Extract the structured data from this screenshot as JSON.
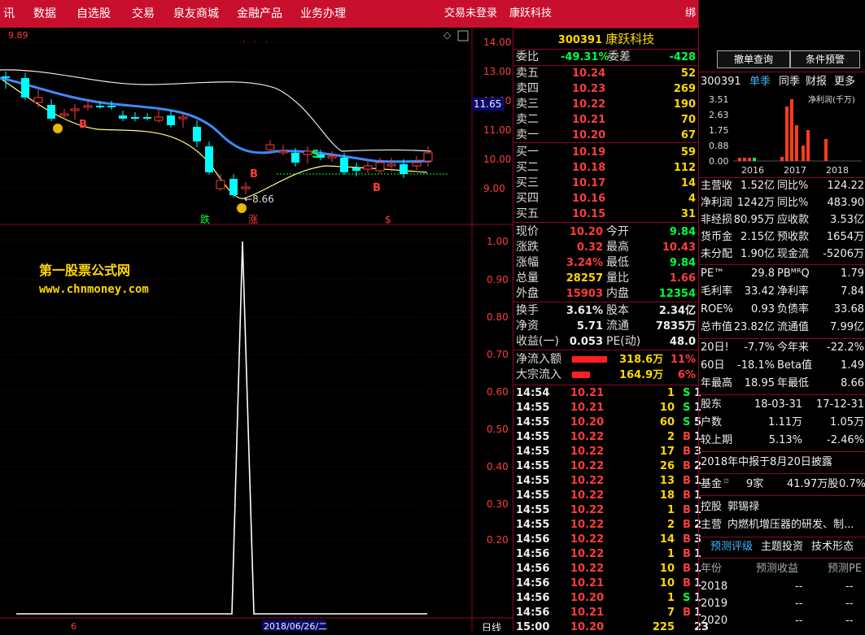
{
  "menu": {
    "items": [
      "讯",
      "数据",
      "自选股",
      "交易",
      "泉友商城",
      "金融产品",
      "业务办理"
    ],
    "login_status": "交易未登录",
    "stock_name_label": "康跃科技",
    "overflow_label": "绑"
  },
  "chart": {
    "low_label_top": "9.89",
    "price_axis": [
      "14.00",
      "13.00",
      "12.00",
      "11.00",
      "10.00",
      "9.00"
    ],
    "current_price_tag": "11.65",
    "low_marker": "8.66",
    "indicator_axis": [
      "1.00",
      "0.90",
      "0.80",
      "0.70",
      "0.60",
      "0.50",
      "0.40",
      "0.30",
      "0.20"
    ],
    "signals": {
      "b": "B",
      "s": "S",
      "die": "跌",
      "zhang": "涨",
      "dollar": "$"
    },
    "bottom_date": "2018/06/26/二",
    "bottom_mark": "6",
    "period_label": "日线",
    "watermark_cn": "第一股票公式网",
    "watermark_url": "www.chnmoney.com",
    "colors": {
      "up": "#ff3c3c",
      "down": "#00ffff",
      "ma": "#3c8cff",
      "band": "#ffffff",
      "yellow_line": "#ffff80"
    }
  },
  "chart_data": {
    "type": "line",
    "title": "",
    "xlabel": "",
    "ylabel": "",
    "ylim": [
      0,
      1.05
    ],
    "x": [
      0,
      1,
      2,
      3,
      4,
      5,
      6,
      7,
      8,
      9,
      10,
      11,
      12,
      13,
      14,
      15
    ],
    "series": [
      {
        "values": [
          0,
          0,
          0,
          0,
          0,
          0,
          0,
          0,
          0,
          0,
          0,
          1,
          0,
          0,
          0,
          0
        ]
      }
    ]
  },
  "quote": {
    "header_code": "300391",
    "header_name": "康跃科技",
    "weibi_label": "委比",
    "weibi_value": "-49.31%",
    "weicha_label": "委差",
    "weicha_value": "-428",
    "sell": [
      {
        "label": "卖五",
        "price": "10.24",
        "vol": "52"
      },
      {
        "label": "卖四",
        "price": "10.23",
        "vol": "269"
      },
      {
        "label": "卖三",
        "price": "10.22",
        "vol": "190"
      },
      {
        "label": "卖二",
        "price": "10.21",
        "vol": "70"
      },
      {
        "label": "卖一",
        "price": "10.20",
        "vol": "67"
      }
    ],
    "buy": [
      {
        "label": "买一",
        "price": "10.19",
        "vol": "59"
      },
      {
        "label": "买二",
        "price": "10.18",
        "vol": "112"
      },
      {
        "label": "买三",
        "price": "10.17",
        "vol": "14"
      },
      {
        "label": "买四",
        "price": "10.16",
        "vol": "4"
      },
      {
        "label": "买五",
        "price": "10.15",
        "vol": "31"
      }
    ],
    "stats": [
      {
        "l1": "现价",
        "v1": "10.20",
        "c1": "red",
        "l2": "今开",
        "v2": "9.84",
        "c2": "green"
      },
      {
        "l1": "涨跌",
        "v1": "0.32",
        "c1": "red",
        "l2": "最高",
        "v2": "10.43",
        "c2": "red"
      },
      {
        "l1": "涨幅",
        "v1": "3.24%",
        "c1": "red",
        "l2": "最低",
        "v2": "9.84",
        "c2": "green"
      },
      {
        "l1": "总量",
        "v1": "28257",
        "c1": "yellow",
        "l2": "量比",
        "v2": "1.66",
        "c2": "red"
      },
      {
        "l1": "外盘",
        "v1": "15903",
        "c1": "red",
        "l2": "内盘",
        "v2": "12354",
        "c2": "green"
      }
    ],
    "stats2": [
      {
        "l1": "换手",
        "v1": "3.61%",
        "l2": "股本",
        "v2": "2.34亿"
      },
      {
        "l1": "净资",
        "v1": "5.71",
        "l2": "流通",
        "v2": "7835万"
      },
      {
        "l1": "收益(一)",
        "v1": "0.053",
        "l2": "PE(动)",
        "v2": "48.0"
      }
    ],
    "flows": [
      {
        "label": "净流入额",
        "value": "318.6万",
        "pct": "11%",
        "fill": 0.9
      },
      {
        "label": "大宗流入",
        "value": "164.9万",
        "pct": "6%",
        "fill": 0.45
      }
    ],
    "ticks": [
      {
        "time": "14:54",
        "price": "10.21",
        "vol": "1",
        "side": "S",
        "cnt": "1"
      },
      {
        "time": "14:55",
        "price": "10.21",
        "vol": "10",
        "side": "S",
        "cnt": "1"
      },
      {
        "time": "14:55",
        "price": "10.20",
        "vol": "60",
        "side": "S",
        "cnt": "5"
      },
      {
        "time": "14:55",
        "price": "10.22",
        "vol": "2",
        "side": "B",
        "cnt": "1"
      },
      {
        "time": "14:55",
        "price": "10.22",
        "vol": "17",
        "side": "B",
        "cnt": "3"
      },
      {
        "time": "14:55",
        "price": "10.22",
        "vol": "26",
        "side": "B",
        "cnt": "2"
      },
      {
        "time": "14:55",
        "price": "10.22",
        "vol": "13",
        "side": "B",
        "cnt": "1"
      },
      {
        "time": "14:55",
        "price": "10.22",
        "vol": "18",
        "side": "B",
        "cnt": "1"
      },
      {
        "time": "14:55",
        "price": "10.22",
        "vol": "1",
        "side": "B",
        "cnt": "1"
      },
      {
        "time": "14:55",
        "price": "10.22",
        "vol": "2",
        "side": "B",
        "cnt": "2"
      },
      {
        "time": "14:56",
        "price": "10.22",
        "vol": "14",
        "side": "B",
        "cnt": "3"
      },
      {
        "time": "14:56",
        "price": "10.22",
        "vol": "1",
        "side": "B",
        "cnt": "1"
      },
      {
        "time": "14:56",
        "price": "10.22",
        "vol": "10",
        "side": "B",
        "cnt": "1"
      },
      {
        "time": "14:56",
        "price": "10.21",
        "vol": "10",
        "side": "B",
        "cnt": "1"
      },
      {
        "time": "14:56",
        "price": "10.20",
        "vol": "1",
        "side": "S",
        "cnt": "1"
      },
      {
        "time": "14:56",
        "price": "10.21",
        "vol": "7",
        "side": "B",
        "cnt": "1"
      },
      {
        "time": "15:00",
        "price": "10.20",
        "vol": "225",
        "side": "",
        "cnt": "23"
      }
    ]
  },
  "f10": {
    "btn_cancel": "撤单查询",
    "btn_alert": "条件预警",
    "tabs": {
      "code": "300391",
      "t1": "单季",
      "t2": "同季",
      "t3": "财报",
      "t4": "更多"
    },
    "mini_chart": {
      "legend": "净利润(千万)",
      "y_ticks": [
        "3.51",
        "2.63",
        "1.75",
        "0.88",
        "0.00"
      ],
      "x_ticks": [
        "2016",
        "2017",
        "2018"
      ]
    },
    "fin_rows": [
      {
        "a": "主营收",
        "b": "1.52亿",
        "c": "同比%",
        "d": "124.22"
      },
      {
        "a": "净利润",
        "b": "1242万",
        "c": "同比%",
        "d": "483.90"
      },
      {
        "a": "非经损",
        "b": "80.95万",
        "c": "应收款",
        "d": "3.53亿"
      },
      {
        "a": "货币金",
        "b": "2.15亿",
        "c": "预收款",
        "d": "1654万"
      },
      {
        "a": "未分配",
        "b": "1.90亿",
        "c": "现金流",
        "d": "-5206万"
      }
    ],
    "pe_rows": [
      {
        "a": "PE™",
        "b": "29.8",
        "c": "PBᴹᴿQ",
        "d": "1.79"
      },
      {
        "a": "毛利率",
        "b": "33.42",
        "c": "净利率",
        "d": "7.84"
      },
      {
        "a": "ROE%",
        "b": "0.93",
        "c": "负债率",
        "d": "33.68"
      },
      {
        "a": "总市值",
        "b": "23.82亿",
        "c": "流通值",
        "d": "7.99亿"
      }
    ],
    "perf_rows": [
      {
        "a": "20日!",
        "b": "-7.7%",
        "c": "今年来",
        "d": "-22.2%"
      },
      {
        "a": "60日",
        "b": "-18.1%",
        "c": "Beta值",
        "d": "1.49"
      },
      {
        "a": "年最高",
        "b": "18.95",
        "c": "年最低",
        "d": "8.66"
      }
    ],
    "holder_rows": [
      {
        "a": "股东",
        "b": "18-03-31",
        "d": "17-12-31"
      },
      {
        "a": "户数",
        "b": "1.11万",
        "d": "1.05万"
      },
      {
        "a": "较上期",
        "b": "5.13%",
        "d": "-2.46%"
      }
    ],
    "report_note": "2018年中报于8月20日披露",
    "fund_label": "基金",
    "fund_sup": "⊡",
    "fund_count": "9家",
    "fund_shares": "41.97万股",
    "fund_pct": "0.7%",
    "control_label": "控股",
    "control_value": "郭锡禄",
    "main_label": "主营",
    "main_value": "内燃机增压器的研发、制...",
    "bottom_tabs": {
      "t1": "预测评级",
      "t2": "主题投资",
      "t3": "技术形态"
    },
    "forecast_head": {
      "a": "年份",
      "b": "预测收益",
      "c": "预测PE"
    },
    "forecast_rows": [
      {
        "year": "2018",
        "eps": "--",
        "pe": "--"
      },
      {
        "year": "2019",
        "eps": "--",
        "pe": "--"
      },
      {
        "year": "2020",
        "eps": "--",
        "pe": "--"
      }
    ]
  }
}
